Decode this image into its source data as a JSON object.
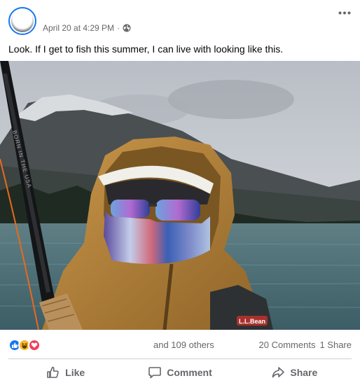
{
  "post": {
    "timestamp": "April 20 at 4:29 PM",
    "separator": "·",
    "privacy_icon": "globe-icon",
    "caption": "Look. If I get to fish this summer, I can live with looking like this.",
    "more_icon": "more-options-icon",
    "photo_description_icon": "post-photo",
    "photo_text": {
      "rod_text": "BORN IN THE USA",
      "jacket_logo": "L.L.Bean"
    }
  },
  "stats": {
    "reactions": [
      "like",
      "haha",
      "love"
    ],
    "others": "and 109 others",
    "comments": "20 Comments",
    "shares": "1 Share"
  },
  "actions": {
    "like": "Like",
    "comment": "Comment",
    "share": "Share"
  },
  "colors": {
    "facebook_blue": "#1877f2",
    "secondary_text": "#65676b",
    "divider": "#ced0d4"
  }
}
